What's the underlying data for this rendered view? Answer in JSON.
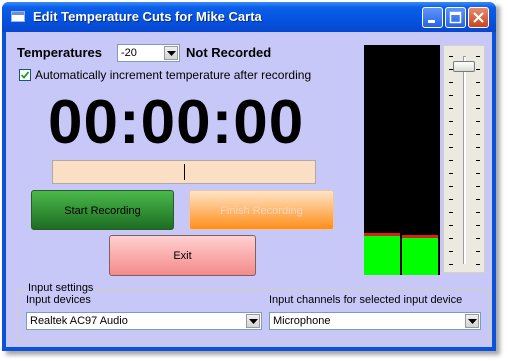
{
  "window": {
    "title": "Edit Temperature Cuts for Mike Carta",
    "controls": {
      "minimize_icon": "minimize-icon",
      "maximize_icon": "maximize-icon",
      "close_icon": "close-icon"
    }
  },
  "temperatures": {
    "label": "Temperatures",
    "selected": "-20",
    "status": "Not Recorded"
  },
  "auto_increment": {
    "label": "Automatically increment temperature after recording",
    "checked": true
  },
  "timer": {
    "value": "00:00:00"
  },
  "progress": {
    "position_fraction": 0.5
  },
  "buttons": {
    "start": "Start Recording",
    "finish": "Finish Recording",
    "exit": "Exit"
  },
  "level_meter": {
    "left_level": 0.17,
    "right_level": 0.16,
    "peak_color": "#d82020",
    "bar_color": "#00ff00"
  },
  "volume_slider": {
    "level": 0.95
  },
  "input_settings": {
    "group_title": "Input settings",
    "devices_label": "Input devices",
    "device_selected": "Realtek AC97 Audio",
    "channels_label": "Input channels for selected input device",
    "channel_selected": "Microphone"
  },
  "colors": {
    "client_bg": "#c8c8f8",
    "titlebar": "#0553e0"
  }
}
